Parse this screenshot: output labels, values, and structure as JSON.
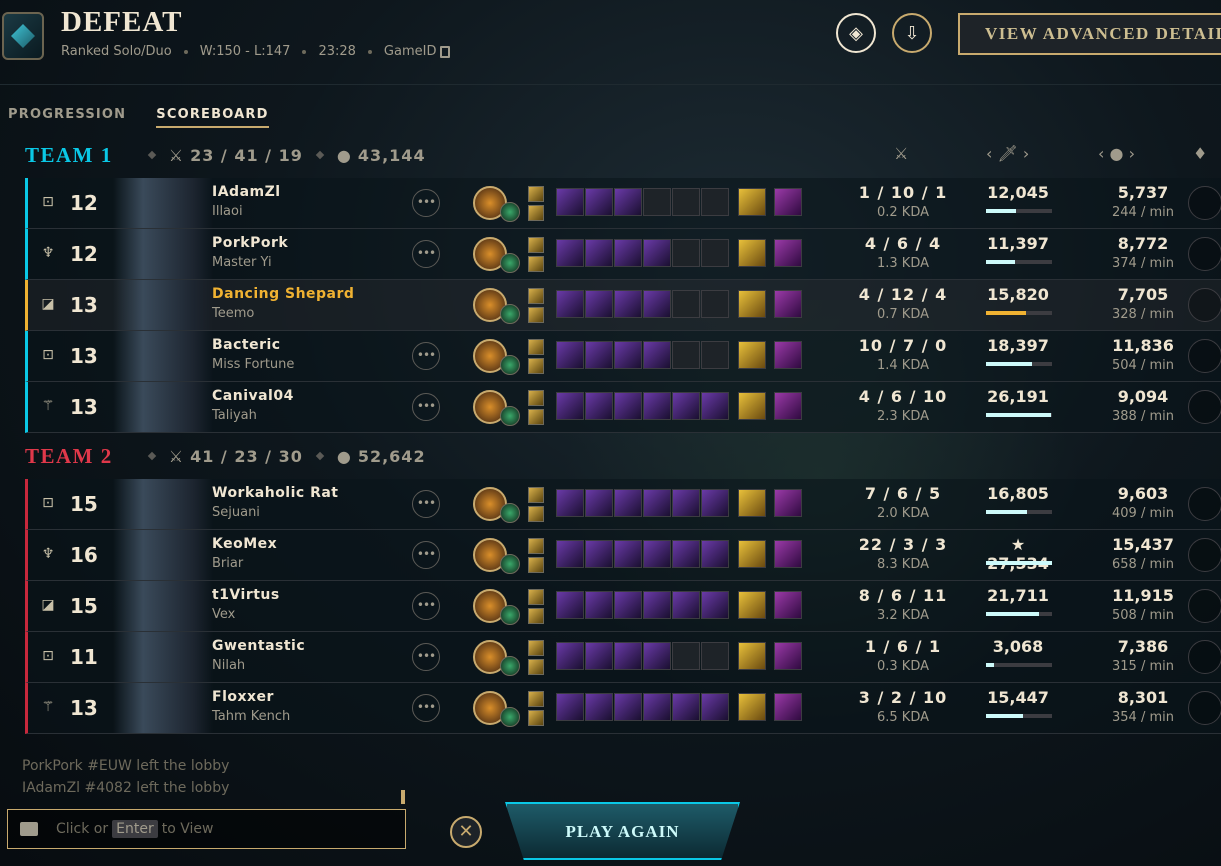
{
  "header": {
    "result": "DEFEAT",
    "queue": "Ranked Solo/Duo",
    "record": "W:150 - L:147",
    "duration": "23:28",
    "game_id_label": "GameID",
    "advanced_label": "VIEW ADVANCED DETAILS"
  },
  "tabs": [
    {
      "label": "PROGRESSION"
    },
    {
      "label": "SCOREBOARD",
      "active": true
    }
  ],
  "team1": {
    "name": "TEAM 1",
    "kda": "23 / 41 / 19",
    "gold": "43,144",
    "players": [
      {
        "level": "12",
        "name": "IAdamZl",
        "champion": "Illaoi",
        "kda": "1 / 10 / 1",
        "kda_ratio": "0.2 KDA",
        "damage": "12,045",
        "damage_frac": 0.46,
        "gold": "5,737",
        "gpm": "244 / min",
        "items": 3
      },
      {
        "level": "12",
        "name": "PorkPork",
        "champion": "Master Yi",
        "kda": "4 / 6 / 4",
        "kda_ratio": "1.3 KDA",
        "damage": "11,397",
        "damage_frac": 0.44,
        "gold": "8,772",
        "gpm": "374 / min",
        "items": 4
      },
      {
        "level": "13",
        "name": "Dancing Shepard",
        "champion": "Teemo",
        "kda": "4 / 12 / 4",
        "kda_ratio": "0.7 KDA",
        "damage": "15,820",
        "damage_frac": 0.6,
        "gold": "7,705",
        "gpm": "328 / min",
        "items": 4,
        "self": true
      },
      {
        "level": "13",
        "name": "Bacteric",
        "champion": "Miss Fortune",
        "kda": "10 / 7 / 0",
        "kda_ratio": "1.4 KDA",
        "damage": "18,397",
        "damage_frac": 0.7,
        "gold": "11,836",
        "gpm": "504 / min",
        "items": 4
      },
      {
        "level": "13",
        "name": "Canival04",
        "champion": "Taliyah",
        "kda": "4 / 6 / 10",
        "kda_ratio": "2.3 KDA",
        "damage": "26,191",
        "damage_frac": 0.98,
        "gold": "9,094",
        "gpm": "388 / min",
        "items": 6
      }
    ]
  },
  "team2": {
    "name": "TEAM 2",
    "kda": "41 / 23 / 30",
    "gold": "52,642",
    "players": [
      {
        "level": "15",
        "name": "Workaholic Rat",
        "champion": "Sejuani",
        "kda": "7 / 6 / 5",
        "kda_ratio": "2.0 KDA",
        "damage": "16,805",
        "damage_frac": 0.62,
        "gold": "9,603",
        "gpm": "409 / min",
        "items": 6
      },
      {
        "level": "16",
        "name": "KeoMex",
        "champion": "Briar",
        "kda": "22 / 3 / 3",
        "kda_ratio": "8.3 KDA",
        "damage": "27,534",
        "damage_frac": 1.0,
        "gold": "15,437",
        "gpm": "658 / min",
        "items": 6,
        "top_damage": true
      },
      {
        "level": "15",
        "name": "t1Virtus",
        "champion": "Vex",
        "kda": "8 / 6 / 11",
        "kda_ratio": "3.2 KDA",
        "damage": "21,711",
        "damage_frac": 0.8,
        "gold": "11,915",
        "gpm": "508 / min",
        "items": 6
      },
      {
        "level": "11",
        "name": "Gwentastic",
        "champion": "Nilah",
        "kda": "1 / 6 / 1",
        "kda_ratio": "0.3 KDA",
        "damage": "3,068",
        "damage_frac": 0.12,
        "gold": "7,386",
        "gpm": "315 / min",
        "items": 4
      },
      {
        "level": "13",
        "name": "Floxxer",
        "champion": "Tahm Kench",
        "kda": "3 / 2 / 10",
        "kda_ratio": "6.5 KDA",
        "damage": "15,447",
        "damage_frac": 0.56,
        "gold": "8,301",
        "gpm": "354 / min",
        "items": 6
      }
    ]
  },
  "chat": {
    "log": [
      "PorkPork #EUW left the lobby",
      "IAdamZl #4082 left the lobby"
    ],
    "prefix": "Click or",
    "key": "Enter",
    "suffix": "to View"
  },
  "play_again": "PLAY AGAIN",
  "top_damage_mark": "★",
  "colors": {
    "team1": "#0ac8e6",
    "team2": "#e0384a",
    "gold_accent": "#c8aa6e",
    "self": "#f0b232"
  }
}
